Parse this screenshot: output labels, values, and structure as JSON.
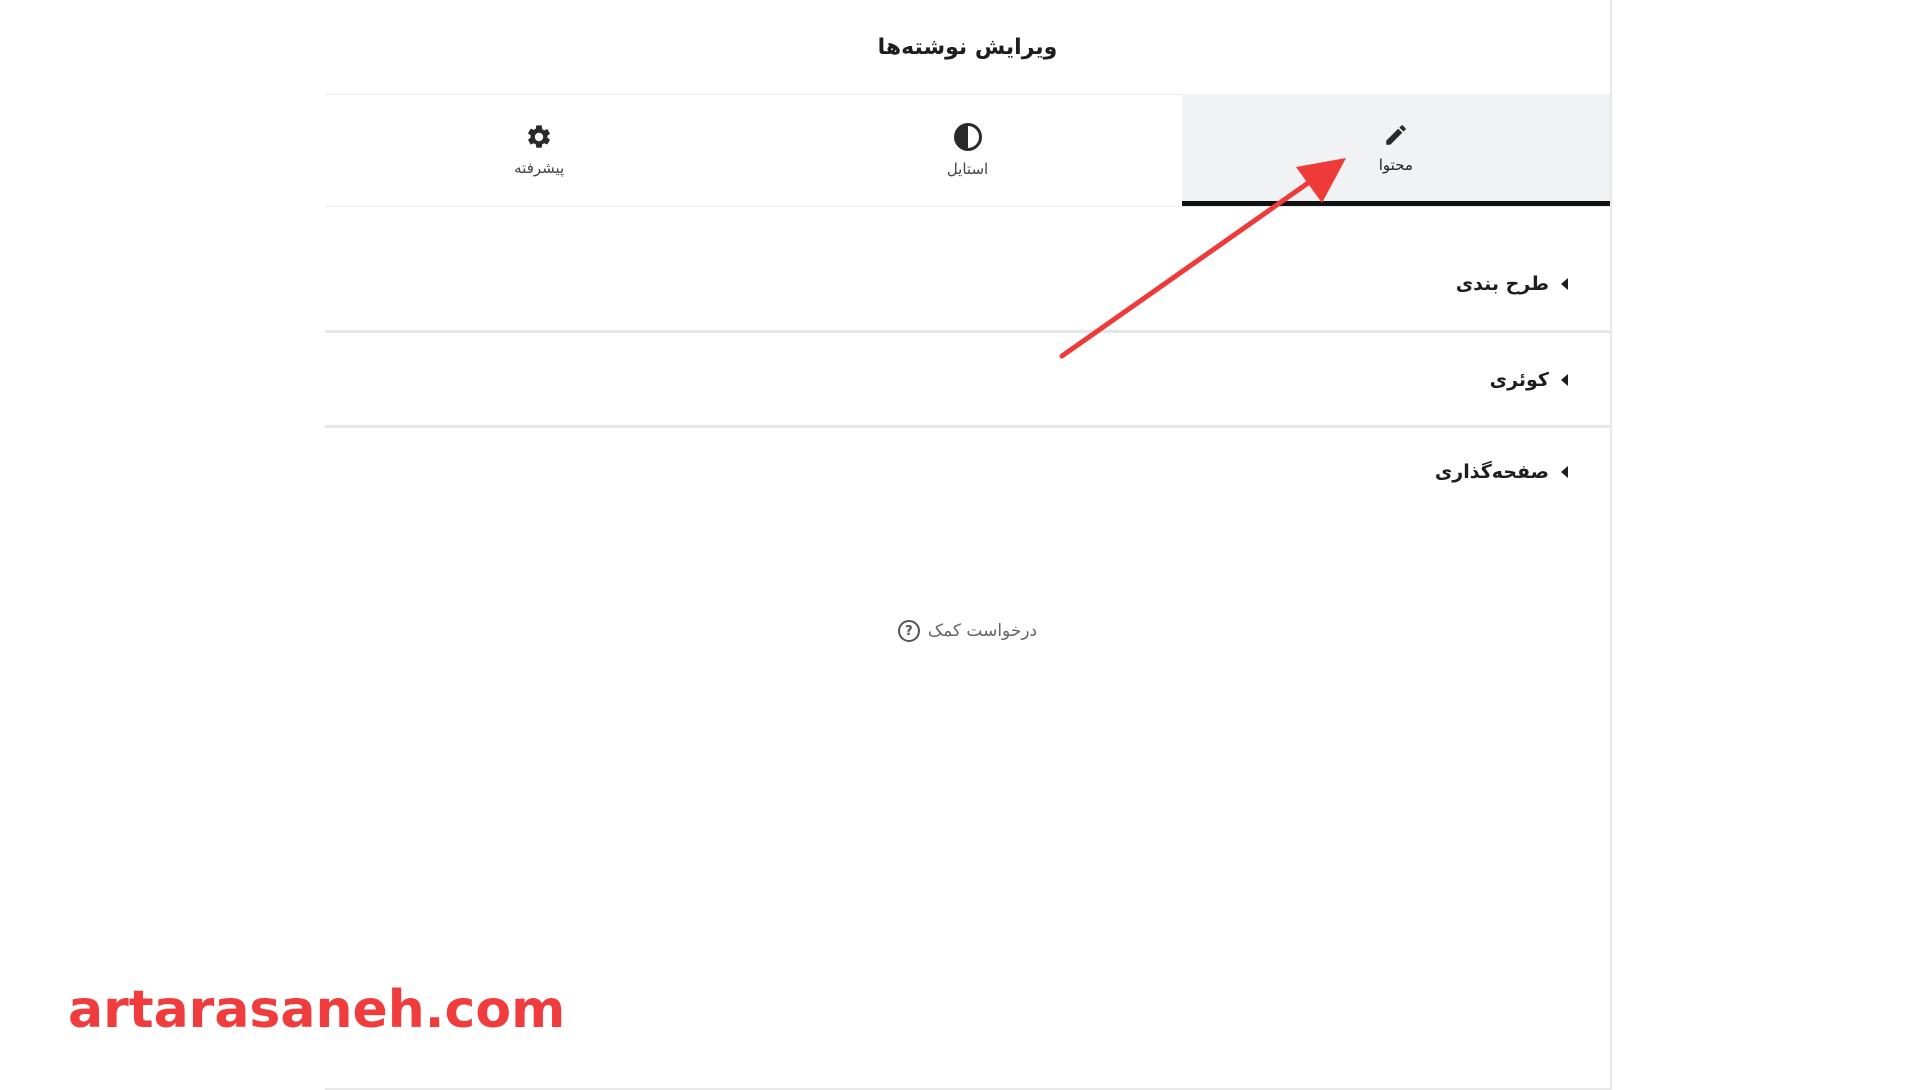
{
  "panel": {
    "title": "ویرایش نوشته‌ها"
  },
  "tabs": [
    {
      "label": "محتوا",
      "icon": "pencil-icon",
      "active": true
    },
    {
      "label": "استایل",
      "icon": "contrast-icon",
      "active": false
    },
    {
      "label": "پیشرفته",
      "icon": "gear-icon",
      "active": false
    }
  ],
  "sections": [
    {
      "label": "طرح بندی"
    },
    {
      "label": "کوئری"
    },
    {
      "label": "صفحه‌گذاری"
    }
  ],
  "help": {
    "label": "درخواست کمک",
    "icon": "?"
  },
  "watermark": "artarasaneh.com",
  "colors": {
    "annotation_arrow": "#ef3a3a",
    "watermark": "#f03c3c",
    "active_tab_bg": "#f1f2f3"
  }
}
